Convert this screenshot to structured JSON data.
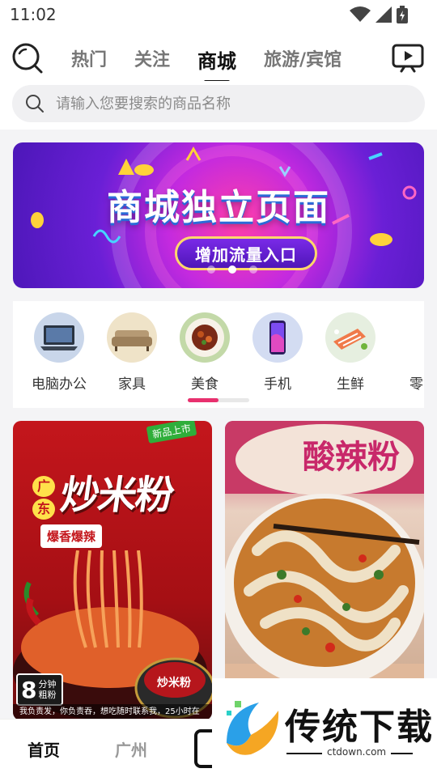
{
  "status_bar": {
    "time": "11:02"
  },
  "header": {
    "tabs": [
      {
        "label": "热门",
        "active": false
      },
      {
        "label": "关注",
        "active": false
      },
      {
        "label": "商城",
        "active": true
      },
      {
        "label": "旅游/宾馆",
        "active": false
      }
    ],
    "search_icon": "search-icon",
    "live_icon": "live-tv-icon"
  },
  "search": {
    "placeholder": "请输入您要搜索的商品名称"
  },
  "banner": {
    "title": "商城独立页面",
    "subtitle": "增加流量入口",
    "active_slide": 1,
    "slide_count": 3
  },
  "categories": {
    "items": [
      {
        "label": "电脑办公",
        "icon": "laptop-icon"
      },
      {
        "label": "家具",
        "icon": "sofa-icon"
      },
      {
        "label": "美食",
        "icon": "food-plate-icon"
      },
      {
        "label": "手机",
        "icon": "smartphone-icon"
      },
      {
        "label": "生鲜",
        "icon": "fresh-salmon-icon"
      },
      {
        "label": "零食",
        "icon": "snack-icon"
      }
    ],
    "scroll_progress": 0.5
  },
  "products": [
    {
      "badge": "新品上市",
      "brand_tag": [
        "广",
        "东"
      ],
      "title": "炒米粉",
      "spicy": "爆香爆辣",
      "time_big": "8",
      "time_small": [
        "分钟",
        "粗粉"
      ],
      "footer": "我负责发，你负责吞，想吃随时联系我，25小时在"
    },
    {
      "title": "酸辣粉"
    }
  ],
  "bottom_nav": {
    "home": "首页",
    "city": "广州"
  },
  "watermark": {
    "text": "传统下载",
    "url": "ctdown.com"
  },
  "colors": {
    "accent": "#e8306e",
    "banner_purple": "#6a1fd6",
    "text_dark": "#111111"
  }
}
